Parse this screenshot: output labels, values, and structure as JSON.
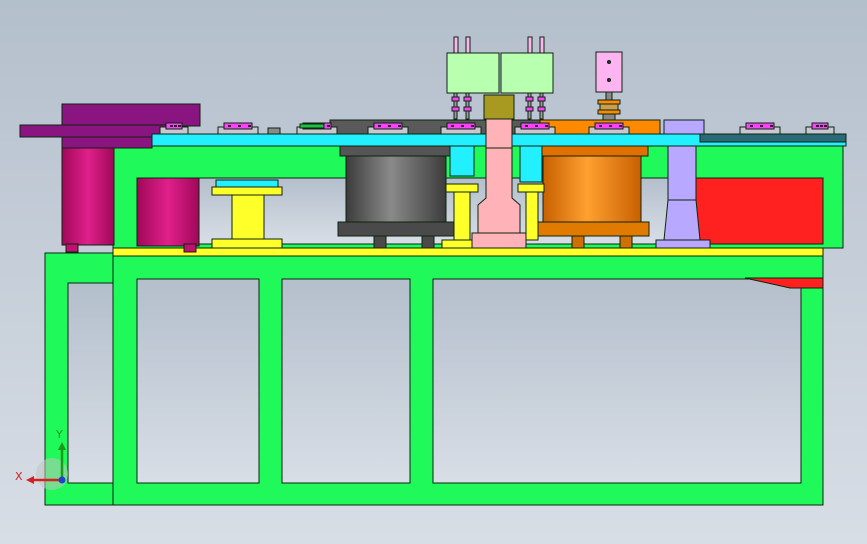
{
  "viewport": {
    "background_top": "#b4bfcc",
    "background_bottom": "#d8dee6"
  },
  "triad": {
    "x_label": "X",
    "y_label": "Y",
    "x_color": "#d42020",
    "y_color": "#1a9a1a",
    "z_color": "#2040d0"
  },
  "colors": {
    "frame": "#1ff95a",
    "outline": "#0c2410",
    "yellow": "#ffff2a",
    "cyan": "#22f0ff",
    "red": "#ff2020",
    "magenta": "#d4107a",
    "purple": "#8a1580",
    "gray": "#6b6b6b",
    "orange": "#ff8a00",
    "pink": "#ffb2b8",
    "lavender": "#b9a8ff",
    "light_green": "#b8ffb0",
    "light_pink": "#ffb4f2",
    "olive": "#a89a20",
    "clip": "#ff40ff"
  }
}
